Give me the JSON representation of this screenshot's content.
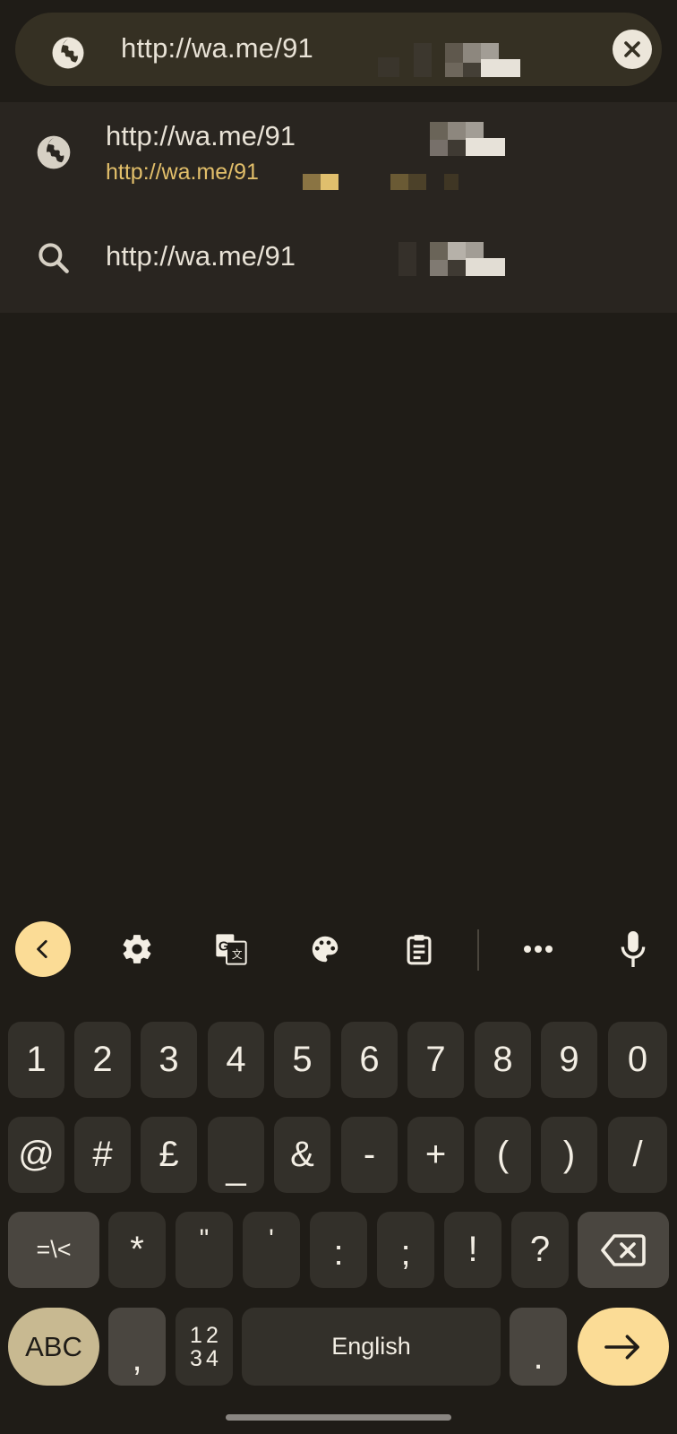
{
  "omnibox": {
    "url_visible": "http://wa.me/91",
    "url_obscured": true,
    "leading_icon": "globe-icon",
    "clear_icon": "close-icon"
  },
  "suggestions": [
    {
      "icon": "globe-icon",
      "title": "http://wa.me/91",
      "subtitle": "http://wa.me/91",
      "obscured": true
    },
    {
      "icon": "search-icon",
      "title": "http://wa.me/91",
      "obscured": true
    }
  ],
  "keyboard": {
    "toolbar": [
      {
        "name": "back",
        "icon": "chevron-left-icon"
      },
      {
        "name": "settings",
        "icon": "gear-icon"
      },
      {
        "name": "translate",
        "icon": "translate-icon"
      },
      {
        "name": "theme",
        "icon": "palette-icon"
      },
      {
        "name": "clipboard",
        "icon": "clipboard-icon"
      },
      {
        "name": "more",
        "icon": "more-horizontal-icon"
      },
      {
        "name": "voice",
        "icon": "microphone-icon"
      }
    ],
    "row1": [
      "1",
      "2",
      "3",
      "4",
      "5",
      "6",
      "7",
      "8",
      "9",
      "0"
    ],
    "row2": [
      "@",
      "#",
      "£",
      "_",
      "&",
      "-",
      "+",
      "(",
      ")",
      "/"
    ],
    "row3": [
      "=\\<",
      "*",
      "\"",
      "'",
      ":",
      ";",
      "!",
      "?"
    ],
    "row4": {
      "abc": "ABC",
      "comma": ",",
      "numpad": [
        "1",
        "2",
        "3",
        "4"
      ],
      "space": "English",
      "period": ".",
      "enter_icon": "arrow-right-icon"
    },
    "colors": {
      "accent": "#fbdc96",
      "tan": "#c8b991",
      "key": "#33302a",
      "key_dark": "#4a4640"
    }
  }
}
